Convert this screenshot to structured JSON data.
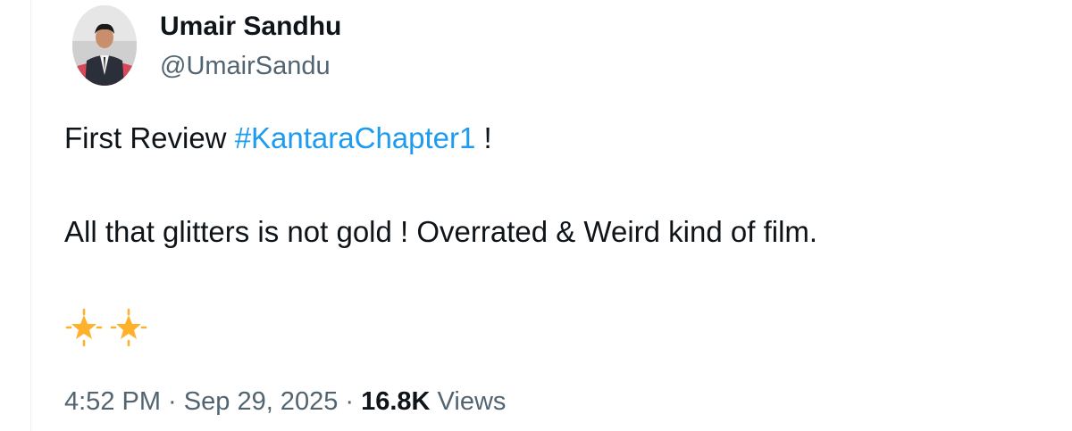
{
  "author": {
    "name": "Umair Sandhu",
    "handle": "@UmairSandu"
  },
  "tweet": {
    "line1_prefix": "First Review ",
    "hashtag": "#KantaraChapter1",
    "line1_suffix": " !",
    "line2": "All that glitters is not gold ! Overrated & Weird kind of film.",
    "stars": [
      "glowing-star",
      "glowing-star"
    ]
  },
  "meta": {
    "time": "4:52 PM",
    "sep1": " · ",
    "date": "Sep 29, 2025",
    "sep2": " · ",
    "views_count": "16.8K",
    "views_label": " Views"
  },
  "colors": {
    "hashtag": "#1d9bf0",
    "secondary_text": "#536471",
    "star": "#ffb12b"
  }
}
